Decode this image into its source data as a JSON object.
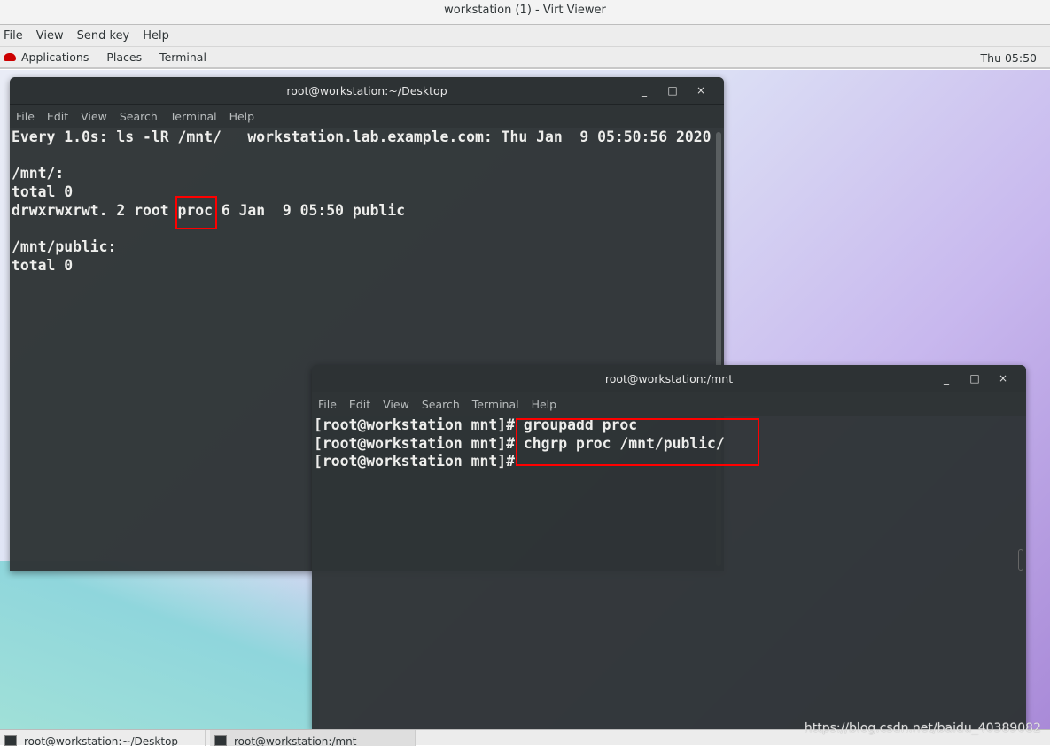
{
  "window": {
    "title": "workstation (1) - Virt Viewer"
  },
  "viewer_menu": [
    "File",
    "View",
    "Send key",
    "Help"
  ],
  "panel": {
    "applications": "Applications",
    "places": "Places",
    "terminal": "Terminal",
    "clock": "Thu 05:50"
  },
  "term1": {
    "title": "root@workstation:~/Desktop",
    "menu": [
      "File",
      "Edit",
      "View",
      "Search",
      "Terminal",
      "Help"
    ],
    "lines": [
      "Every 1.0s: ls -lR /mnt/   workstation.lab.example.com: Thu Jan  9 05:50:56 2020",
      "",
      "/mnt/:",
      "total 0",
      "drwxrwxrwt. 2 root proc 6 Jan  9 05:50 public",
      "",
      "/mnt/public:",
      "total 0"
    ]
  },
  "term2": {
    "title": "root@workstation:/mnt",
    "menu": [
      "File",
      "Edit",
      "View",
      "Search",
      "Terminal",
      "Help"
    ],
    "lines": [
      "[root@workstation mnt]# groupadd proc",
      "[root@workstation mnt]# chgrp proc /mnt/public/",
      "[root@workstation mnt]#"
    ]
  },
  "window_controls": {
    "minimize": "_",
    "maximize": "□",
    "close": "×"
  },
  "taskbar": [
    "root@workstation:~/Desktop",
    "root@workstation:/mnt"
  ],
  "watermark": "https://blog.csdn.net/baidu_40389082",
  "colors": {
    "highlight": "#ff0000",
    "terminal_bg": "#2e3436"
  }
}
